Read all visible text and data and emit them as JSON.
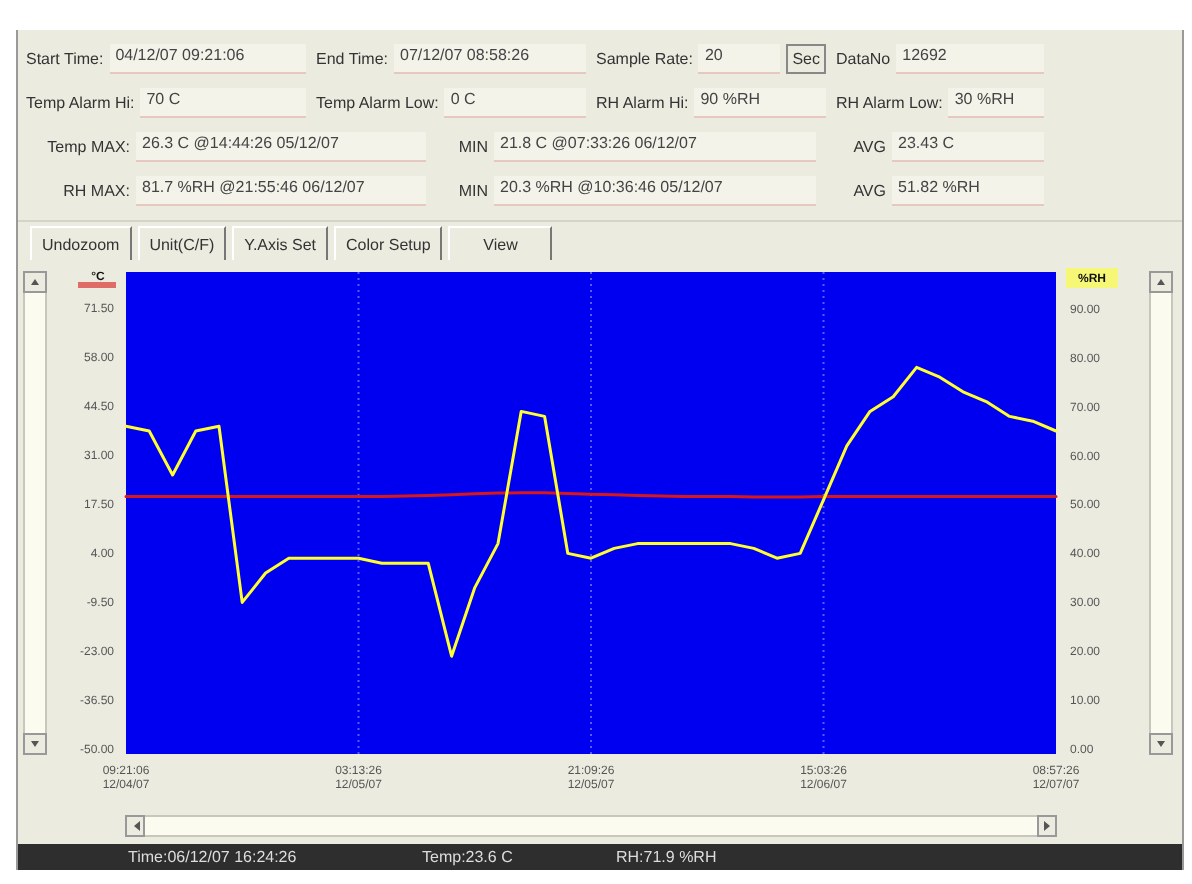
{
  "summary": {
    "rows": [
      [
        {
          "label": "Start Time:",
          "value": "04/12/07 09:21:06"
        },
        {
          "label": "End Time:",
          "value": "07/12/07 08:58:26"
        },
        {
          "label": "Sample Rate:",
          "value": "20",
          "unit_button": "Sec"
        },
        {
          "label": "DataNo",
          "value": "12692"
        }
      ],
      [
        {
          "label": "Temp Alarm Hi:",
          "value": "70 C"
        },
        {
          "label": "Temp Alarm Low:",
          "value": "0 C"
        },
        {
          "label": "RH Alarm Hi:",
          "value": "90 %RH"
        },
        {
          "label": "RH Alarm Low:",
          "value": "30 %RH"
        }
      ],
      [
        {
          "label": "Temp MAX:",
          "value": "26.3 C @14:44:26 05/12/07"
        },
        {
          "label": "MIN",
          "value": "21.8 C @07:33:26 06/12/07"
        },
        {
          "label": "AVG",
          "value": "23.43 C"
        }
      ],
      [
        {
          "label": "RH MAX:",
          "value": "81.7 %RH @21:55:46 06/12/07"
        },
        {
          "label": "MIN",
          "value": "20.3 %RH @10:36:46 05/12/07"
        },
        {
          "label": "AVG",
          "value": "51.82 %RH"
        }
      ]
    ]
  },
  "toolbar": [
    "Undozoom",
    "Unit(C/F)",
    "Y.Axis Set",
    "Color Setup",
    "View"
  ],
  "chart": {
    "chart_data": {
      "type": "line",
      "ylabel": "°C",
      "y2label": "%RH",
      "categories": [
        "09:21:06 12/04/07",
        null,
        null,
        null,
        null,
        null,
        null,
        null,
        null,
        null,
        "03:13:26 12/05/07",
        null,
        null,
        null,
        null,
        null,
        null,
        null,
        null,
        null,
        "21:09:26 12/05/07",
        null,
        null,
        null,
        null,
        null,
        null,
        null,
        null,
        null,
        "15:03:26 12/06/07",
        null,
        null,
        null,
        null,
        null,
        null,
        null,
        null,
        null,
        "08:57:26 12/07/07"
      ],
      "ylim": [
        -51.5,
        81.5
      ],
      "y2lim": [
        -1,
        97.5
      ],
      "grid": "x",
      "yticks": [
        {
          "value": 71.5,
          "label": "71.50"
        },
        {
          "value": 58,
          "label": "58.00"
        },
        {
          "value": 44.5,
          "label": "44.50"
        },
        {
          "value": 31,
          "label": "31.00"
        },
        {
          "value": 17.5,
          "label": "17.50"
        },
        {
          "value": 4,
          "label": "4.00"
        },
        {
          "value": -9.5,
          "label": "-9.50"
        },
        {
          "value": -23,
          "label": "-23.00"
        },
        {
          "value": -36.5,
          "label": "-36.50"
        },
        {
          "value": -50,
          "label": "-50.00"
        }
      ],
      "y2ticks": [
        {
          "value": 90,
          "label": "90.00"
        },
        {
          "value": 80,
          "label": "80.00"
        },
        {
          "value": 70,
          "label": "70.00"
        },
        {
          "value": 60,
          "label": "60.00"
        },
        {
          "value": 50,
          "label": "50.00"
        },
        {
          "value": 40,
          "label": "40.00"
        },
        {
          "value": 30,
          "label": "30.00"
        },
        {
          "value": 20,
          "label": "20.00"
        },
        {
          "value": 10,
          "label": "10.00"
        },
        {
          "value": 0,
          "label": "0.00"
        }
      ],
      "series": [
        {
          "color": "#d81818",
          "values": [
            19.5,
            19.5,
            19.5,
            19.5,
            19.5,
            19.6,
            19.6,
            19.6,
            19.6,
            19.6,
            19.6,
            19.6,
            19.7,
            19.8,
            20.0,
            20.3,
            20.5,
            20.6,
            20.6,
            20.4,
            20.2,
            20.0,
            19.8,
            19.7,
            19.6,
            19.5,
            19.5,
            19.4,
            19.4,
            19.4,
            19.5,
            19.5,
            19.5,
            19.5,
            19.5,
            19.5,
            19.5,
            19.5,
            19.5,
            19.5,
            19.5
          ]
        },
        {
          "axis": "y2",
          "color": "#ffff30",
          "values": [
            66,
            65,
            56,
            65,
            66,
            30,
            36,
            39,
            39,
            39,
            39,
            38,
            38,
            38,
            19,
            33,
            42,
            69,
            68,
            40,
            39,
            41,
            42,
            42,
            42,
            42,
            42,
            41,
            39,
            40,
            51,
            62,
            69,
            72,
            78,
            76,
            73,
            71,
            68,
            67,
            65
          ]
        }
      ]
    }
  },
  "status_bar": [
    "Time:06/12/07 16:24:26",
    "Temp:23.6 C",
    "RH:71.9 %RH"
  ]
}
